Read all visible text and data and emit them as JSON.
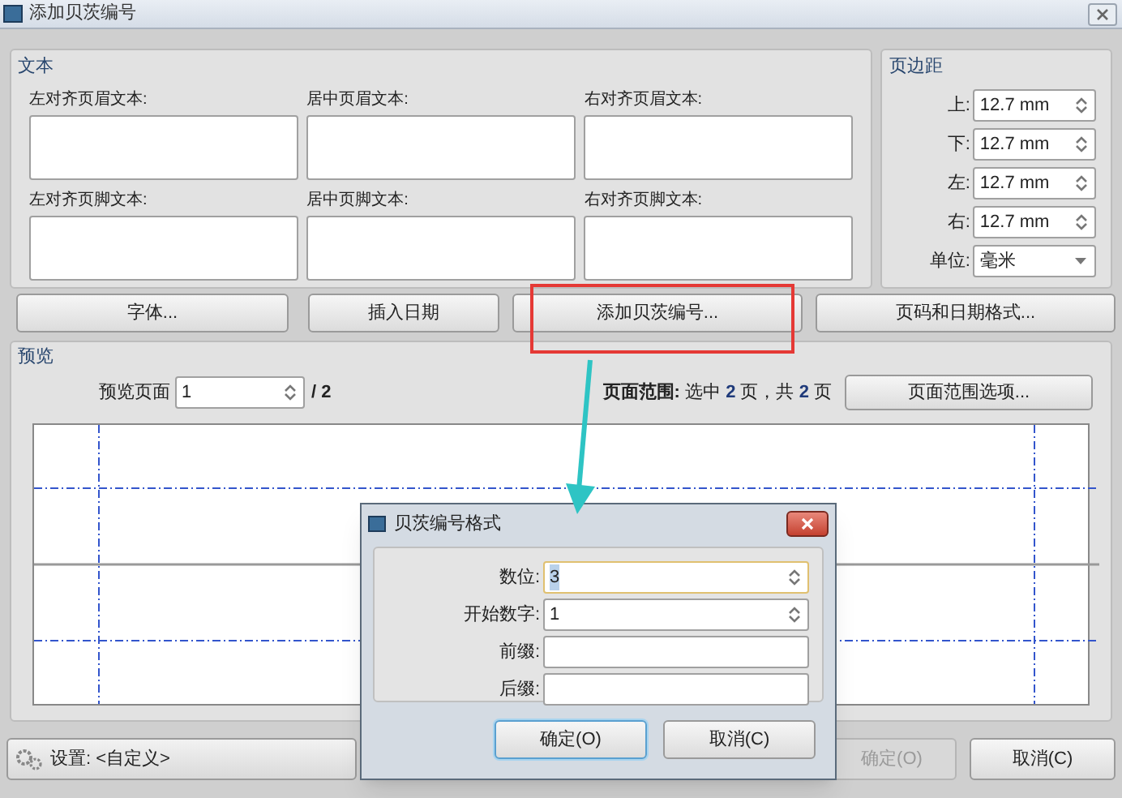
{
  "window": {
    "title": "添加贝茨编号"
  },
  "text_group": {
    "title": "文本",
    "fields": [
      {
        "label": "左对齐页眉文本:"
      },
      {
        "label": "居中页眉文本:"
      },
      {
        "label": "右对齐页眉文本:"
      },
      {
        "label": "左对齐页脚文本:"
      },
      {
        "label": "居中页脚文本:"
      },
      {
        "label": "右对齐页脚文本:"
      }
    ]
  },
  "margins": {
    "title": "页边距",
    "fields": [
      {
        "label": "上:",
        "value": "12.7 mm"
      },
      {
        "label": "下:",
        "value": "12.7 mm"
      },
      {
        "label": "左:",
        "value": "12.7 mm"
      },
      {
        "label": "右:",
        "value": "12.7 mm"
      }
    ],
    "unit": {
      "label": "单位:",
      "value": "毫米"
    }
  },
  "buttons": [
    {
      "label": "字体..."
    },
    {
      "label": "插入日期"
    },
    {
      "label": "添加贝茨编号..."
    },
    {
      "label": "页码和日期格式..."
    }
  ],
  "preview": {
    "title": "预览",
    "page_label": "预览页面",
    "page_value": "1",
    "page_total": "/ 2",
    "range_text": "**页面范围:** 选中 **2** 页，共 **2** 页",
    "range_button": "页面范围选项..."
  },
  "footer": {
    "settings": "设置: <自定义>",
    "buttons": [
      {
        "label": "确定(O)",
        "disabled": true
      },
      {
        "label": "取消(C)",
        "disabled": false
      }
    ]
  },
  "subdialog": {
    "title": "贝茨编号格式",
    "fields": [
      {
        "label": "数位:",
        "value": "3",
        "kind": "spin",
        "focused": true
      },
      {
        "label": "开始数字:",
        "value": "1",
        "kind": "spin",
        "focused": false
      },
      {
        "label": "前缀:",
        "kind": "text",
        "focused": false
      },
      {
        "label": "后缀:",
        "kind": "text",
        "focused": false
      }
    ],
    "buttons": [
      {
        "label": "确定(O)",
        "default": true
      },
      {
        "label": "取消(C)",
        "default": false
      }
    ]
  }
}
